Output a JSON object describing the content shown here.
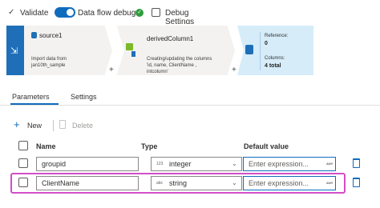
{
  "toolbar": {
    "validate_label": "Validate",
    "dataflow_debug_label": "Data flow debug",
    "debug_settings_label": "Debug Settings"
  },
  "flow": {
    "source": {
      "title": "source1",
      "description_line1": "Import data from",
      "description_line2": "jan10th_sample"
    },
    "derived": {
      "title": "derivedColumn1",
      "description_line1": "Creating/updating the columns",
      "description_line2": "'id, name, ClientName ,",
      "description_line3": "intcolumn'"
    },
    "sink": {
      "reference_label": "Reference:",
      "reference_value": "0",
      "columns_label": "Columns:",
      "columns_value": "4 total"
    },
    "plus_glyph": "+"
  },
  "tabs": [
    {
      "label": "Parameters",
      "active": true
    },
    {
      "label": "Settings",
      "active": false
    }
  ],
  "actions": {
    "new_label": "New",
    "delete_label": "Delete"
  },
  "grid": {
    "headers": {
      "name": "Name",
      "type": "Type",
      "default": "Default value"
    },
    "rows": [
      {
        "name": "groupid",
        "type_badge": "123",
        "type": "integer",
        "default_placeholder": "Enter expression...",
        "any": "ANY"
      },
      {
        "name": "ClientName",
        "type_badge": "abc",
        "type": "string",
        "default_placeholder": "Enter expression...",
        "any": "ANY"
      }
    ]
  },
  "colors": {
    "accent": "#0f6cbd",
    "highlight": "#d14fc6",
    "success": "#2e9c3b"
  }
}
